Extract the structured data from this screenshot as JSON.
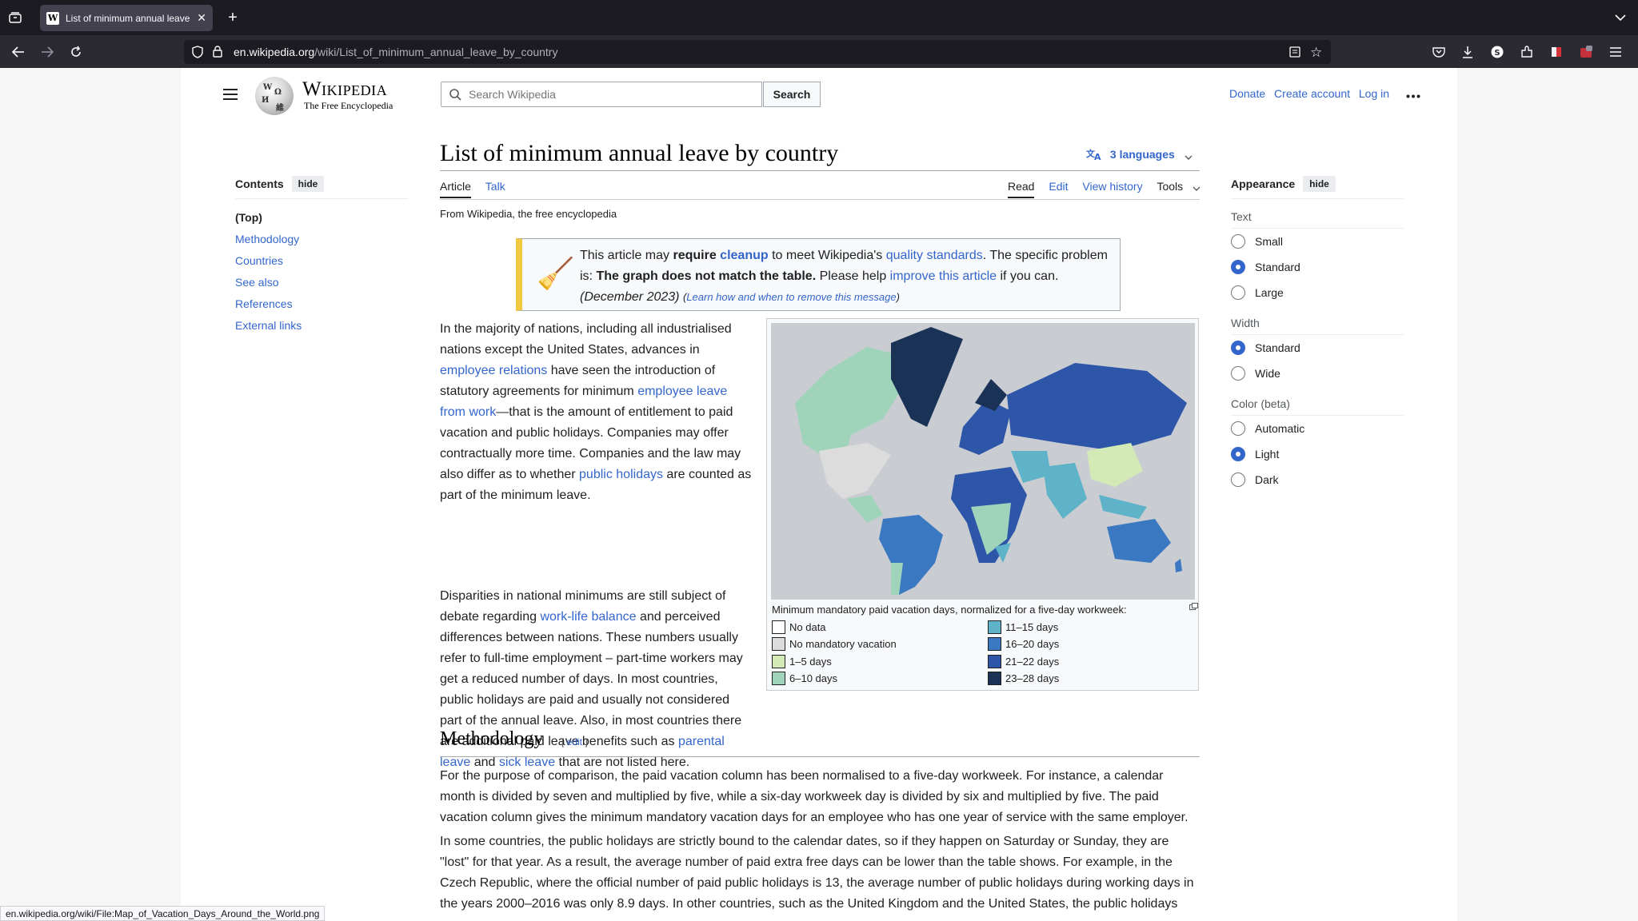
{
  "browser": {
    "tab_title": "List of minimum annual leave by country",
    "favicon": "W",
    "url_domain": "en.wikipedia.org",
    "url_path": "/wiki/List_of_minimum_annual_leave_by_country"
  },
  "header": {
    "wordmark": "Wikipedia",
    "tagline": "The Free Encyclopedia",
    "search_placeholder": "Search Wikipedia",
    "search_button": "Search",
    "donate": "Donate",
    "create_account": "Create account",
    "log_in": "Log in"
  },
  "toc": {
    "title": "Contents",
    "hide": "hide",
    "items": [
      "(Top)",
      "Methodology",
      "Countries",
      "See also",
      "References",
      "External links"
    ]
  },
  "article": {
    "title": "List of minimum annual leave by country",
    "languages": "3 languages",
    "tab_article": "Article",
    "tab_talk": "Talk",
    "tab_read": "Read",
    "tab_edit": "Edit",
    "tab_history": "View history",
    "tab_tools": "Tools",
    "from": "From Wikipedia, the free encyclopedia"
  },
  "ambox": {
    "t1": "This article may ",
    "t2": "require",
    "t3": "cleanup",
    "t4": " to meet Wikipedia's ",
    "t5": "quality standards",
    "t6": ". The specific problem is: ",
    "t7": "The graph does not match the table.",
    "t8": " Please help ",
    "t9": "improve this article",
    "t10": " if you can.",
    "date": "(December 2023)",
    "learn": "Learn how and when to remove this message"
  },
  "intro": {
    "p1a": "In the majority of nations, including all industrialised nations except the United States, advances in ",
    "p1b": "employee relations",
    "p1c": " have seen the introduction of statutory agreements for minimum ",
    "p1d": "employee leave from work",
    "p1e": "—that is the amount of entitlement to paid vacation and public holidays. Companies may offer contractually more time. Companies and the law may also differ as to whether ",
    "p1f": "public holidays",
    "p1g": " are counted as part of the minimum leave.",
    "p2a": "Disparities in national minimums are still subject of debate regarding ",
    "p2b": "work-life balance",
    "p2c": " and perceived differences between nations. These numbers usually refer to full-time employment – part-time workers may get a reduced number of days. In most countries, public holidays are paid and usually not considered part of the annual leave. Also, in most countries there are additional paid leave benefits such as ",
    "p2d": "parental leave",
    "p2e": " and ",
    "p2f": "sick leave",
    "p2g": " that are not listed here."
  },
  "figure": {
    "caption": "Minimum mandatory paid vacation days, normalized for a five-day workweek:",
    "legend": [
      {
        "label": "No data",
        "color": "#ffffff"
      },
      {
        "label": "No mandatory vacation",
        "color": "#dcdcdc"
      },
      {
        "label": "1–5 days",
        "color": "#d3eab6"
      },
      {
        "label": "6–10 days",
        "color": "#9fd4bb"
      },
      {
        "label": "11–15 days",
        "color": "#5fb3c8"
      },
      {
        "label": "16–20 days",
        "color": "#3a78c2"
      },
      {
        "label": "21–22 days",
        "color": "#2d55a8"
      },
      {
        "label": "23–28 days",
        "color": "#1b3257"
      }
    ]
  },
  "methodology": {
    "heading": "Methodology",
    "edit": "edit",
    "p1": "For the purpose of comparison, the paid vacation column has been normalised to a five-day workweek. For instance, a calendar month is divided by seven and multiplied by five, while a six-day workweek day is divided by six and multiplied by five. The paid vacation column gives the minimum mandatory vacation days for an employee who has one year of service with the same employer.",
    "p2": "In some countries, the public holidays are strictly bound to the calendar dates, so if they happen on Saturday or Sunday, they are \"lost\" for that year. As a result, the average number of paid extra free days can be lower than the table shows. For example, in the Czech Republic, where the official number of paid public holidays is 13, the average number of public holidays during working days in the years 2000–2016 was only 8.9 days. In other countries, such as the United Kingdom and the United States, the public holidays"
  },
  "appearance": {
    "title": "Appearance",
    "hide": "hide",
    "text_label": "Text",
    "text_opts": [
      "Small",
      "Standard",
      "Large"
    ],
    "width_label": "Width",
    "width_opts": [
      "Standard",
      "Wide"
    ],
    "color_label": "Color (beta)",
    "color_opts": [
      "Automatic",
      "Light",
      "Dark"
    ]
  },
  "status_url": "en.wikipedia.org/wiki/File:Map_of_Vacation_Days_Around_the_World.png"
}
